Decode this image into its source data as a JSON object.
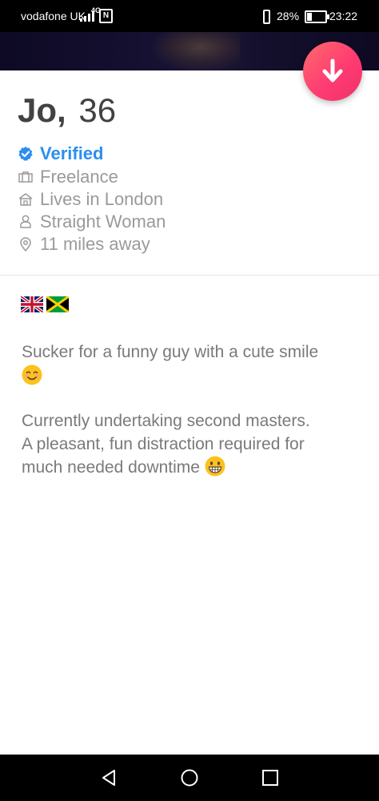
{
  "status_bar": {
    "carrier": "vodafone UK",
    "network": "4G",
    "nfc": "N",
    "battery_percent": "28%",
    "time": "23:22"
  },
  "profile": {
    "name": "Jo,",
    "age": "36",
    "verified_label": "Verified",
    "details": [
      {
        "icon": "briefcase-icon",
        "text": "Freelance"
      },
      {
        "icon": "home-icon",
        "text": "Lives in London"
      },
      {
        "icon": "person-icon",
        "text": "Straight Woman"
      },
      {
        "icon": "location-pin-icon",
        "text": "11 miles away"
      }
    ]
  },
  "bio": {
    "flags": [
      "uk-flag-icon",
      "jamaica-flag-icon"
    ],
    "paragraph_1": "Sucker for a funny guy with a cute smile",
    "paragraph_2_line_1": "Currently undertaking second masters.",
    "paragraph_2_line_2": "A pleasant, fun distraction required for",
    "paragraph_2_line_3": "much needed downtime"
  },
  "colors": {
    "verified_blue": "#2b8ef0",
    "fab_pink": "#fe3c72",
    "text_grey": "#9a9a9a"
  }
}
